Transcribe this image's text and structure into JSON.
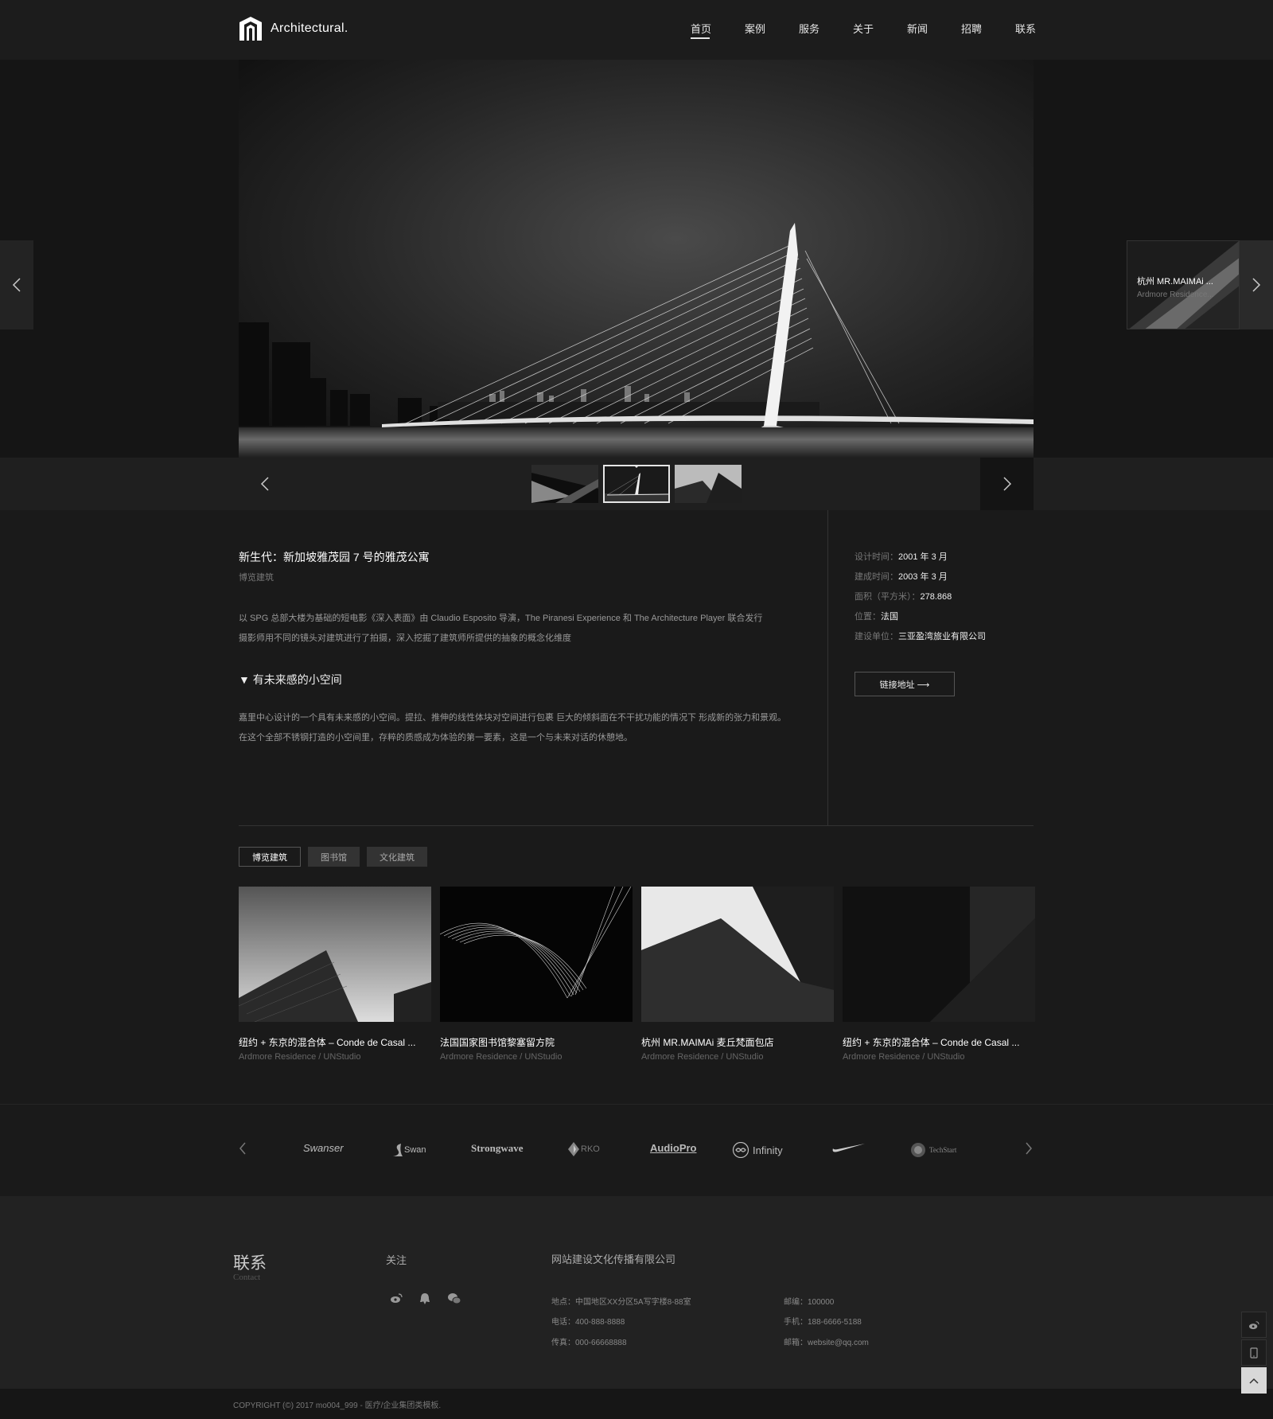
{
  "header": {
    "logo_text": "Architectural.",
    "nav": [
      {
        "label": "首页",
        "active": true
      },
      {
        "label": "案例"
      },
      {
        "label": "服务"
      },
      {
        "label": "关于"
      },
      {
        "label": "新闻"
      },
      {
        "label": "招聘"
      },
      {
        "label": "联系"
      }
    ]
  },
  "hero": {
    "next_preview": {
      "title": "杭州 MR.MAIMAi ...",
      "subtitle": "Ardmore Residence..."
    },
    "active_thumb": 2
  },
  "detail": {
    "title": "新生代：新加坡雅茂园 7 号的雅茂公寓",
    "category": "博览建筑",
    "intro_line1": "以 SPG 总部大楼为基础的短电影《深入表面》由 Claudio Esposito 导演，The Piranesi Experience 和 The Architecture Player 联合发行",
    "intro_line2": "摄影师用不同的镜头对建筑进行了拍摄，深入挖掘了建筑师所提供的抽象的概念化维度",
    "section_heading": "▼ 有未来感的小空间",
    "body_line1": "嘉里中心设计的一个具有未来感的小空间。提拉、推伸的线性体块对空间进行包裹  巨大的倾斜面在不干扰功能的情况下  形成新的张力和景观。",
    "body_line2": "在这个全部不锈钢打造的小空间里，存粹的质感成为体验的第一要素，这是一个与未来对话的休憩地。",
    "meta": [
      {
        "key": "设计时间：",
        "value": "2001 年 3 月"
      },
      {
        "key": "建成时间：",
        "value": "2003 年 3 月"
      },
      {
        "key": "面积（平方米）：",
        "value": "278.868"
      },
      {
        "key": "位置：",
        "value": "法国"
      },
      {
        "key": "建设单位：",
        "value": "三亚盈湾旅业有限公司"
      }
    ],
    "link_label": "链接地址 ⟶"
  },
  "tabs": [
    {
      "label": "博览建筑",
      "active": true
    },
    {
      "label": "图书馆"
    },
    {
      "label": "文化建筑"
    }
  ],
  "cards": [
    {
      "title": "纽约 + 东京的混合体 – Conde de Casal ...",
      "subtitle": "Ardmore Residence / UNStudio"
    },
    {
      "title": "法国国家图书馆黎塞留方院",
      "subtitle": "Ardmore Residence / UNStudio"
    },
    {
      "title": "杭州 MR.MAIMAi 麦丘梵面包店",
      "subtitle": "Ardmore Residence / UNStudio"
    },
    {
      "title": "纽约 + 东京的混合体 – Conde de Casal ...",
      "subtitle": "Ardmore Residence / UNStudio"
    }
  ],
  "brands": [
    "Swanser",
    "Swan",
    "Strongwave",
    "RKO",
    "AudioPro",
    "Infinity",
    "nike-swoosh",
    "TechStart"
  ],
  "footer": {
    "contact_title": "联系",
    "contact_en": "Contact",
    "follow_title": "关注",
    "company": "网站建设文化传播有限公司",
    "address": "地点：中国地区XX分区5A写字楼8-88室",
    "phone": "电话：400-888-8888",
    "fax": "传真：000-66668888",
    "postcode": "邮编：100000",
    "mobile": "手机：188-6666-5188",
    "email": "邮箱：website@qq.com",
    "copyright": "COPYRIGHT (©) 2017 mo004_999 - 医疗/企业集团类模板."
  },
  "icons": [
    "weibo-icon",
    "qq-icon",
    "wechat-icon",
    "mobile-icon",
    "arrow-up-icon"
  ],
  "colors": {
    "background": "#1a1a1a",
    "header": "#1c1c1c",
    "footer": "#222222",
    "text": "#eeeeee",
    "muted": "#777777"
  }
}
